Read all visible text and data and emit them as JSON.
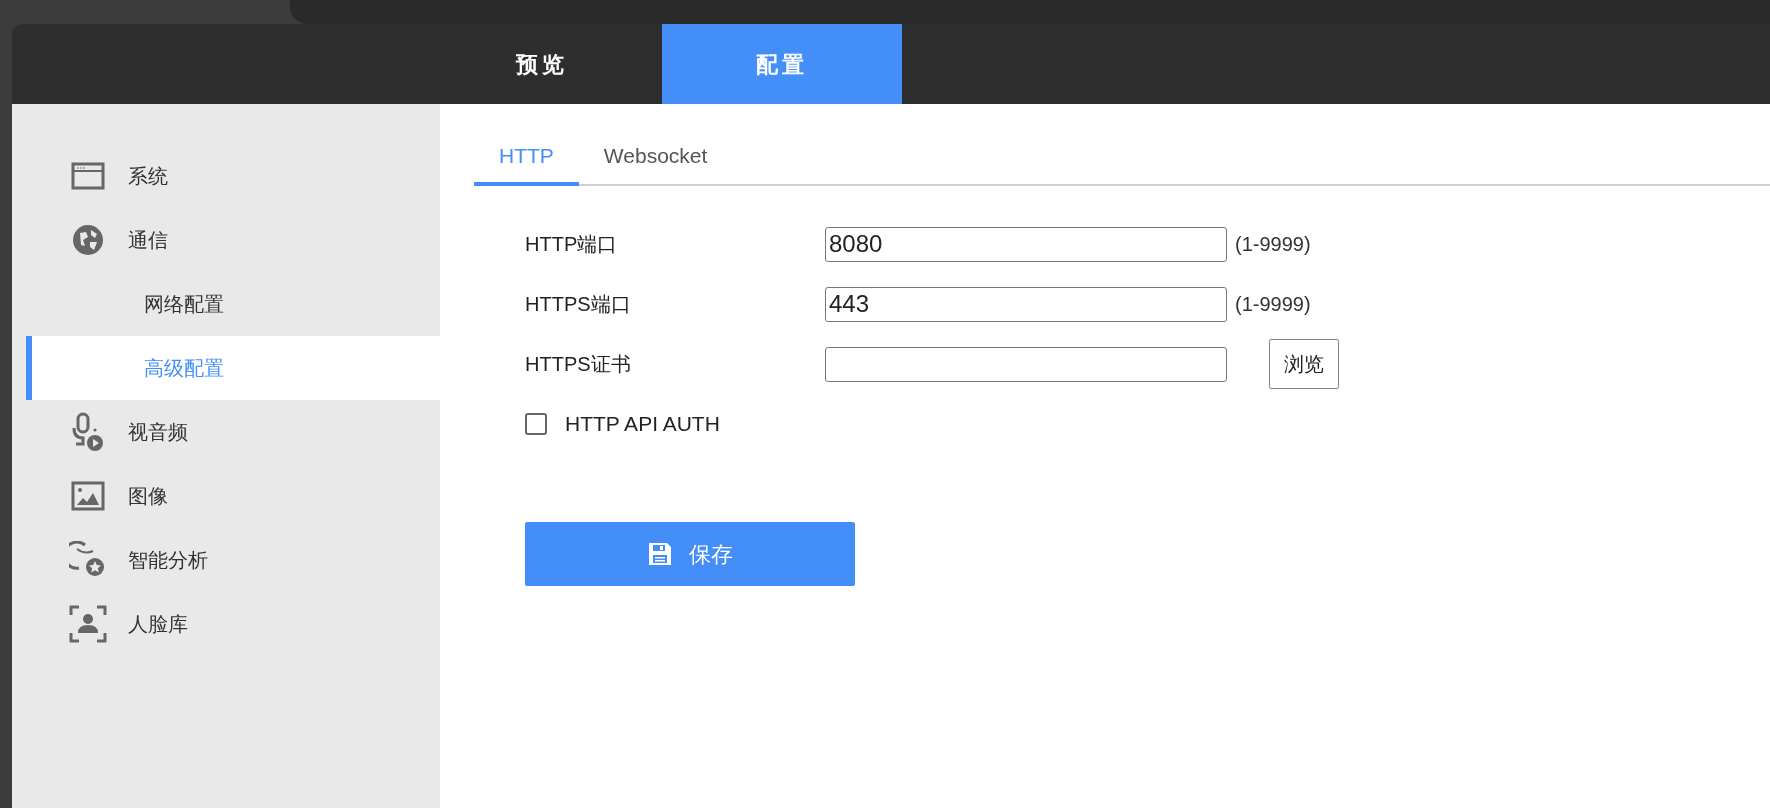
{
  "header_tabs": [
    {
      "label": "预览",
      "selected": false
    },
    {
      "label": "配置",
      "selected": true
    }
  ],
  "sidebar": {
    "items": [
      {
        "label": "系统"
      },
      {
        "label": "通信",
        "children": [
          {
            "label": "网络配置",
            "selected": false
          },
          {
            "label": "高级配置",
            "selected": true
          }
        ]
      },
      {
        "label": "视音频"
      },
      {
        "label": "图像"
      },
      {
        "label": "智能分析"
      },
      {
        "label": "人脸库"
      }
    ]
  },
  "sub_tabs": [
    {
      "label": "HTTP",
      "selected": true
    },
    {
      "label": "Websocket",
      "selected": false
    }
  ],
  "form": [
    {
      "kind": "text",
      "label": "HTTP端口",
      "value": "8080",
      "hint": "(1-9999)"
    },
    {
      "kind": "text",
      "label": "HTTPS端口",
      "value": "443",
      "hint": "(1-9999)"
    },
    {
      "kind": "file",
      "label": "HTTPS证书",
      "button": "浏览"
    },
    {
      "kind": "checkbox",
      "label": "HTTP API AUTH",
      "checked": false
    }
  ],
  "save_button": "保存"
}
